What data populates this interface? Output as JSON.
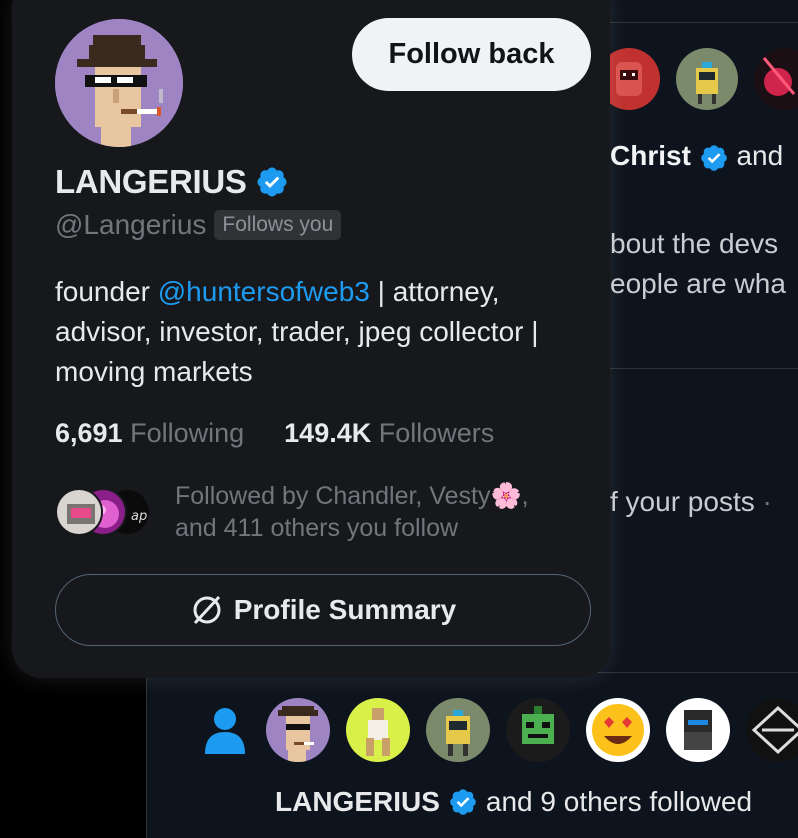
{
  "hover_card": {
    "follow_button_label": "Follow back",
    "display_name": "LANGERIUS",
    "handle": "@Langerius",
    "follows_you_badge": "Follows you",
    "bio": {
      "prefix": "founder ",
      "mention": "@huntersofweb3",
      "line1_rest": " | attorney,",
      "line2": "advisor, investor, trader, jpeg collector |",
      "line3": "moving markets"
    },
    "stats": {
      "following_count": "6,691",
      "following_label": "Following",
      "followers_count": "149.4K",
      "followers_label": "Followers"
    },
    "mutuals": {
      "line1": "Followed by Chandler, Vesty",
      "emoji": "🌸",
      "line1_end": ",",
      "line2": "and 411 others you follow",
      "avatar_badge_text": "ap"
    },
    "profile_summary_label": "Profile Summary"
  },
  "background_feed": {
    "text_christ": "Christ",
    "text_and": "and",
    "text_about_devs": "bout the devs",
    "text_people_are": "eople are wha",
    "text_your_posts": "f your posts",
    "text_dot": "·",
    "likes_caption_name": "LANGERIUS",
    "likes_caption_rest": "and 9 others followed"
  },
  "colors": {
    "accent": "#1d9bf0",
    "card_bg": "#16181c",
    "feed_bg": "#0e141d",
    "muted_text": "#71767b",
    "avatar_bg": "#9f84c4"
  },
  "icons": [
    "verified-badge-icon",
    "person-icon",
    "profile-summary-icon"
  ]
}
